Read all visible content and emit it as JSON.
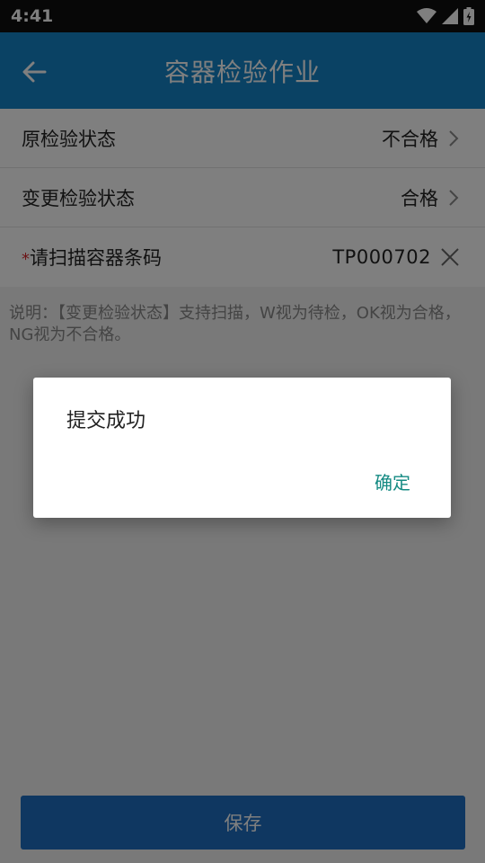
{
  "status_bar": {
    "time": "4:41"
  },
  "app_bar": {
    "title": "容器检验作业"
  },
  "form": {
    "original_status": {
      "label": "原检验状态",
      "value": "不合格"
    },
    "changed_status": {
      "label": "变更检验状态",
      "value": "合格"
    },
    "barcode": {
      "required_mark": "*",
      "label": "请扫描容器条码",
      "value": "TP000702"
    }
  },
  "note": "说明：【变更检验状态】支持扫描，W视为待检，OK视为合格，NG视为不合格。",
  "save_button": {
    "label": "保存"
  },
  "dialog": {
    "message": "提交成功",
    "confirm_label": "确定"
  },
  "colors": {
    "app_bar": "#1484c8",
    "save_button": "#1e6fc2",
    "dialog_action": "#148a83",
    "required": "#d9262c"
  }
}
